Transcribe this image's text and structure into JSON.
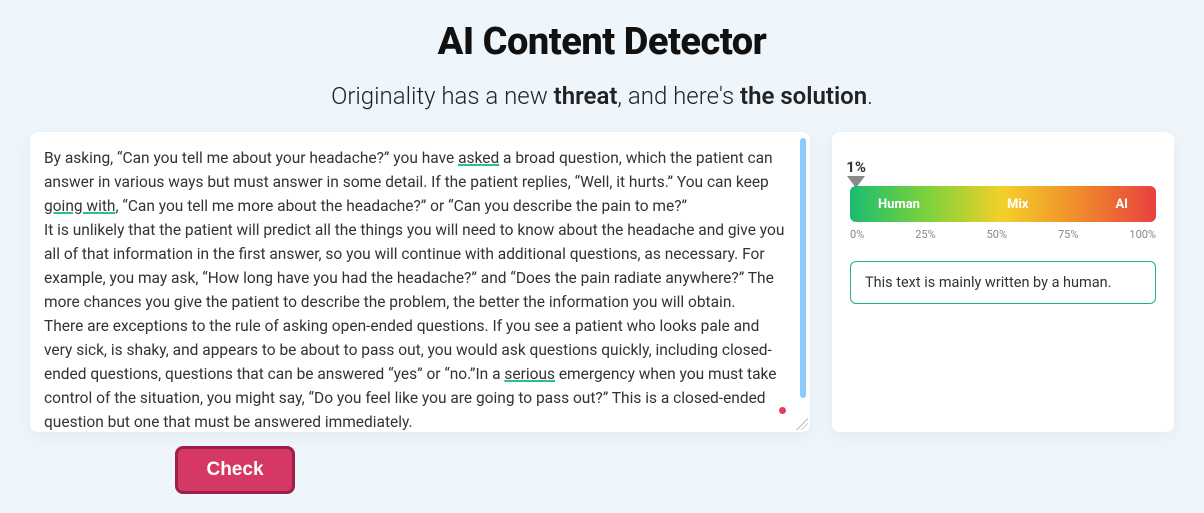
{
  "header": {
    "title": "AI Content Detector",
    "subtitle_parts": [
      "Originality has a new ",
      "threat",
      ", and here's ",
      "the solution",
      "."
    ]
  },
  "input": {
    "text_html": "By asking, “Can you tell me about your headache?” you have <u>asked</u> a broad question, which the patient can answer in various ways but must answer in some detail. If the patient replies, “Well, it hurts.” You can keep <u>going with</u>, “Can you tell me more about the headache?” or “Can you describe the pain to me?”\nIt is unlikely that the patient will predict all the things you will need to know about the headache and give you all of that information in the first answer, so you will continue with additional questions, as necessary. For example, you may ask, “How long have you had the headache?” and “Does the pain radiate anywhere?” The more chances you give the patient to describe the problem, the better the information you will obtain.\nThere are exceptions to the rule of asking open-ended questions. If you see a patient who looks pale and very sick, is shaky, and appears to be about  to pass out, you would ask questions quickly, including closed-ended questions, questions that can be answered “yes” or “no.”In a <u>serious</u> emergency when you must take control of the situation, you might say, “Do you feel like you are going to pass out?” This is a closed-ended question but one that must be answered immediately."
  },
  "actions": {
    "check_label": "Check"
  },
  "result": {
    "percent_value": 1,
    "percent_display": "1%",
    "gauge_labels": {
      "left": "Human",
      "mid": "Mix",
      "right": "AI"
    },
    "ticks": [
      "0%",
      "25%",
      "50%",
      "75%",
      "100%"
    ],
    "verdict_text": "This text is mainly written by a human."
  }
}
